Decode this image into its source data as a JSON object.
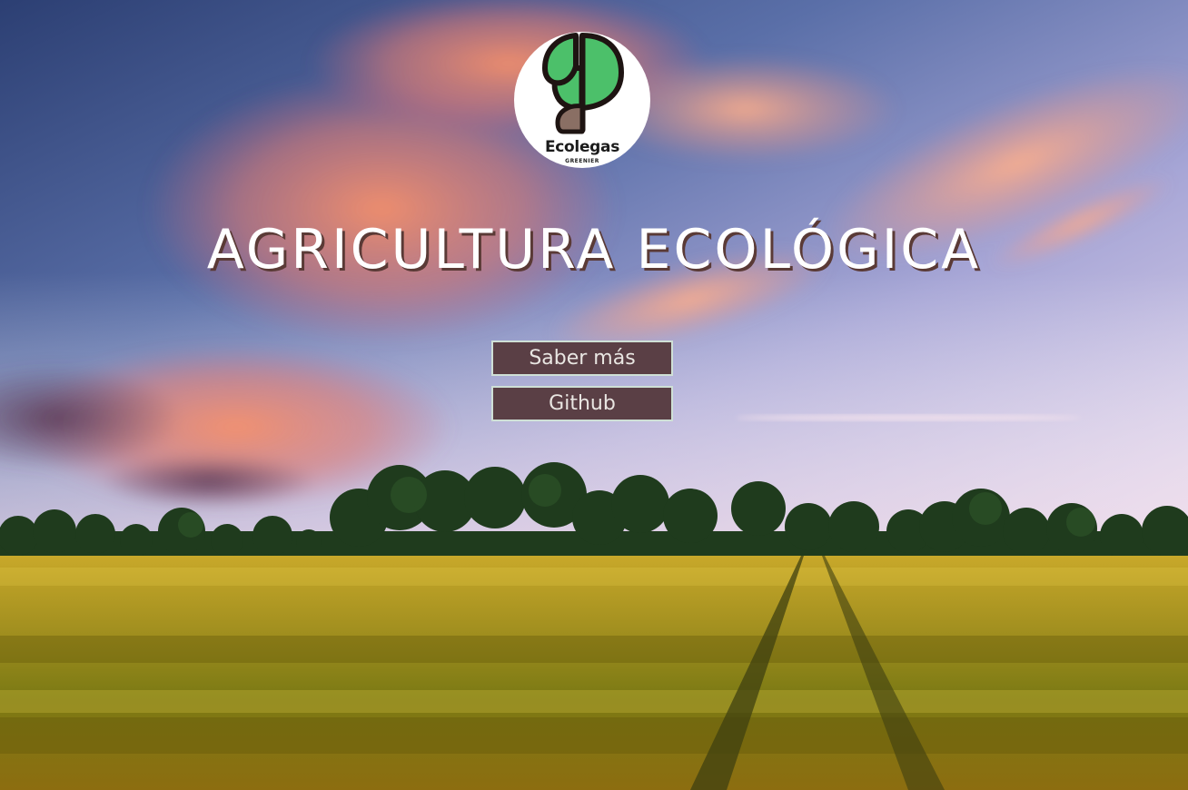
{
  "logo": {
    "name": "Ecolegas",
    "tagline": "GREENIER",
    "icon": "leaf-seed-icon"
  },
  "hero": {
    "title": "AGRICULTURA ECOLÓGICA"
  },
  "actions": {
    "more_label": "Saber más",
    "github_label": "Github"
  },
  "colors": {
    "button_bg": "#5a3f45",
    "button_border": "#cfe0d6",
    "title_shadow": "#5a3a36",
    "logo_green": "#4cc06a"
  }
}
